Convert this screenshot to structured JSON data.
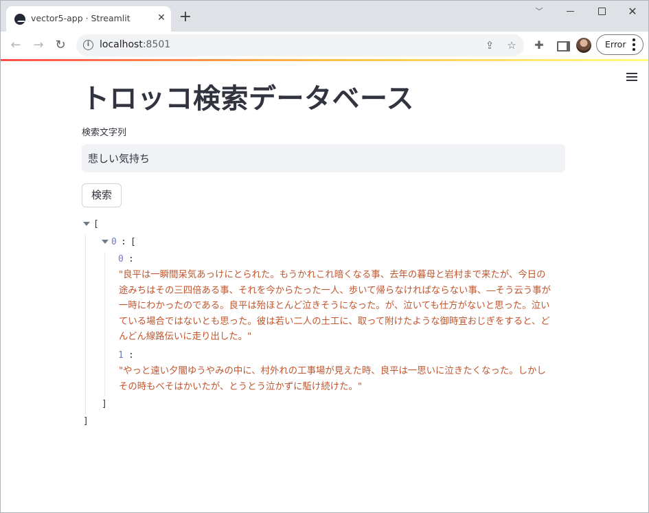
{
  "browser": {
    "tab_title": "vector5-app · Streamlit",
    "url_host": "localhost",
    "url_port": ":8501",
    "profile_button_label": "Error"
  },
  "app": {
    "title": "トロッコ検索データベース",
    "search": {
      "label": "検索文字列",
      "value": "悲しい気持ち"
    },
    "search_button_label": "検索"
  },
  "results": {
    "open_bracket": "[",
    "close_bracket": "]",
    "group_key": "0",
    "items": [
      {
        "key": "0",
        "text": "\"良平は一瞬間呆気あっけにとられた。もうかれこれ暗くなる事、去年の暮母と岩村まで来たが、今日の途みちはその三四倍ある事、それを今からたった一人、歩いて帰らなければならない事、―そう云う事が一時にわかったのである。良平は殆ほとんど泣きそうになった。が、泣いても仕方がないと思った。泣いている場合ではないとも思った。彼は若い二人の土工に、取って附けたような御時宜おじぎをすると、どんどん線路伝いに走り出した。\""
      },
      {
        "key": "1",
        "text": "\"やっと遠い夕闇ゆうやみの中に、村外れの工事場が見えた時、良平は一思いに泣きたくなった。しかしその時もべそはかいたが、とうとう泣かずに駈け続けた。\""
      }
    ]
  }
}
